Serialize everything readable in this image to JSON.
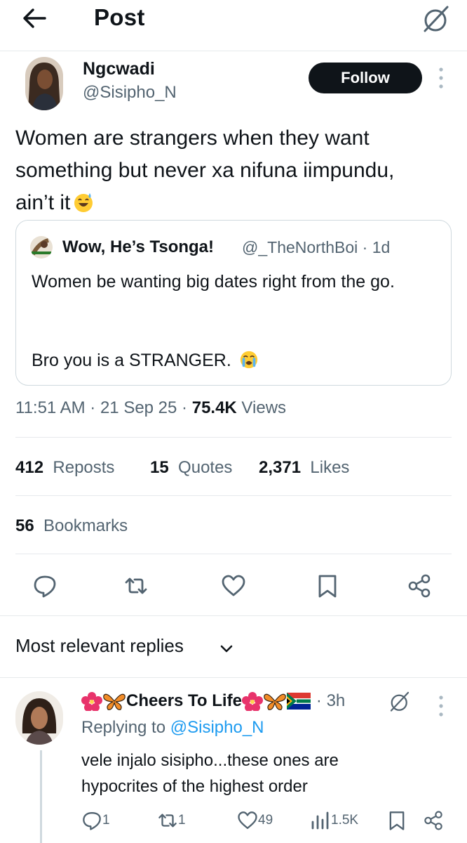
{
  "header": {
    "title": "Post"
  },
  "author": {
    "name": "Ngcwadi",
    "handle": "@Sisipho_N",
    "follow_label": "Follow"
  },
  "post": {
    "text": "Women are strangers when they want something but never xa nifuna iimpundu, ain’t it",
    "emoji": "sweat-smile-emoji"
  },
  "quote": {
    "name": "Wow, He’s Tsonga!",
    "meta": "@_TheNorthBoi · 1d",
    "line1": "Women be wanting big dates right from the go.",
    "line2": "Bro you is a STRANGER.",
    "emoji": "loudly-crying-emoji"
  },
  "meta": {
    "time_date": "11:51 AM · 21 Sep 25 · ",
    "views_count": "75.4K",
    "views_label": " Views"
  },
  "stats": {
    "reposts_count": "412",
    "reposts_label": "Reposts",
    "quotes_count": "15",
    "quotes_label": "Quotes",
    "likes_count": "2,371",
    "likes_label": "Likes",
    "bookmarks_count": "56",
    "bookmarks_label": "Bookmarks"
  },
  "actions": [
    "reply-icon",
    "repost-icon",
    "like-icon",
    "bookmark-icon",
    "share-icon"
  ],
  "replies_header": {
    "title": "Most relevant replies"
  },
  "reply": {
    "name": "Cheers To Life",
    "time": "· 3h",
    "replying_prefix": "Replying to ",
    "replying_handle": "@Sisipho_N",
    "text": "vele injalo sisipho...these ones are hypocrites of the highest order",
    "decorations": [
      "hibiscus-emoji",
      "butterfly-emoji",
      "south-africa-flag"
    ],
    "counts": {
      "replies": "1",
      "reposts": "1",
      "likes": "49",
      "views": "1.5K"
    }
  },
  "colors": {
    "text": "#0f1419",
    "secondary": "#536471",
    "link": "#1d9bf0",
    "border": "#e6e9ec"
  }
}
